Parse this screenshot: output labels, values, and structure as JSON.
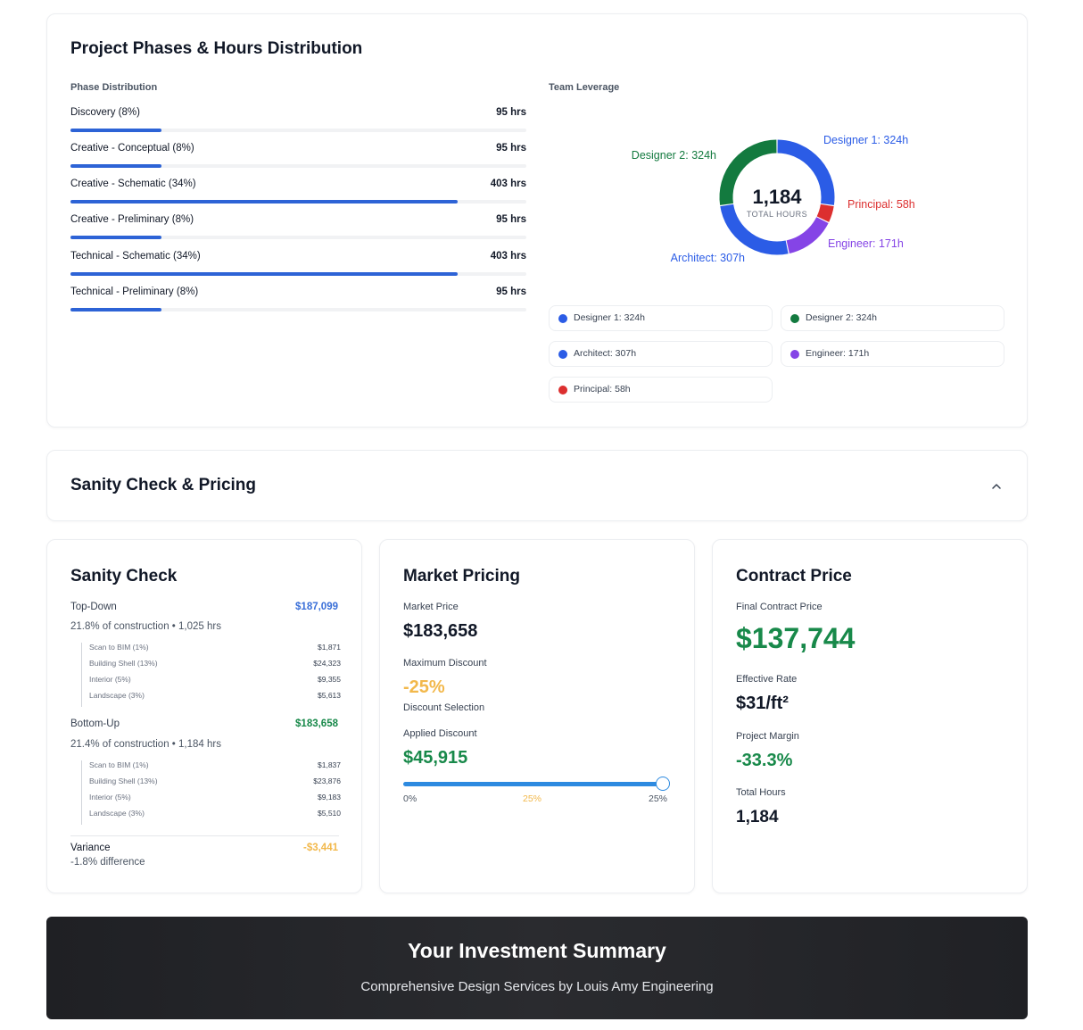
{
  "phases_card": {
    "title": "Project Phases & Hours Distribution",
    "phase_label": "Phase Distribution",
    "team_label": "Team Leverage",
    "phases": [
      {
        "name": "Discovery (8%)",
        "hours": "95 hrs",
        "fraction": 0.2
      },
      {
        "name": "Creative - Conceptual (8%)",
        "hours": "95 hrs",
        "fraction": 0.2
      },
      {
        "name": "Creative - Schematic (34%)",
        "hours": "403 hrs",
        "fraction": 0.85
      },
      {
        "name": "Creative - Preliminary (8%)",
        "hours": "95 hrs",
        "fraction": 0.2
      },
      {
        "name": "Technical - Schematic (34%)",
        "hours": "403 hrs",
        "fraction": 0.85
      },
      {
        "name": "Technical - Preliminary (8%)",
        "hours": "95 hrs",
        "fraction": 0.2
      }
    ]
  },
  "chart_data": {
    "type": "pie",
    "center_value": "1,184",
    "center_label": "TOTAL HOURS",
    "slices": [
      {
        "name": "Designer 1",
        "value": 324,
        "label": "Designer 1: 324h",
        "color": "#2b5ce6"
      },
      {
        "name": "Principal",
        "value": 58,
        "label": "Principal: 58h",
        "color": "#dc2f2f"
      },
      {
        "name": "Engineer",
        "value": 171,
        "label": "Engineer: 171h",
        "color": "#8544e6"
      },
      {
        "name": "Architect",
        "value": 307,
        "label": "Architect: 307h",
        "color": "#2b5ce6"
      },
      {
        "name": "Designer 2",
        "value": 324,
        "label": "Designer 2: 324h",
        "color": "#137a3f"
      }
    ]
  },
  "legend": [
    {
      "label": "Designer 1: 324h",
      "color": "#2b5ce6"
    },
    {
      "label": "Designer 2: 324h",
      "color": "#137a3f"
    },
    {
      "label": "Architect: 307h",
      "color": "#2b5ce6"
    },
    {
      "label": "Engineer: 171h",
      "color": "#8544e6"
    },
    {
      "label": "Principal: 58h",
      "color": "#dc2f2f"
    }
  ],
  "sanity_header": {
    "title": "Sanity Check & Pricing",
    "icon": "chevron-up-icon"
  },
  "sanity_check": {
    "title": "Sanity Check",
    "top_down": {
      "label": "Top-Down",
      "value": "$187,099",
      "sub": "21.8% of construction • 1,025 hrs",
      "items": [
        {
          "label": "Scan to BIM (1%)",
          "value": "$1,871"
        },
        {
          "label": "Building Shell (13%)",
          "value": "$24,323"
        },
        {
          "label": "Interior (5%)",
          "value": "$9,355"
        },
        {
          "label": "Landscape (3%)",
          "value": "$5,613"
        }
      ]
    },
    "bottom_up": {
      "label": "Bottom-Up",
      "value": "$183,658",
      "sub": "21.4% of construction • 1,184 hrs",
      "items": [
        {
          "label": "Scan to BIM (1%)",
          "value": "$1,837"
        },
        {
          "label": "Building Shell (13%)",
          "value": "$23,876"
        },
        {
          "label": "Interior (5%)",
          "value": "$9,183"
        },
        {
          "label": "Landscape (3%)",
          "value": "$5,510"
        }
      ]
    },
    "variance": {
      "label": "Variance",
      "value": "-$3,441",
      "sub": "-1.8% difference"
    }
  },
  "market_pricing": {
    "title": "Market Pricing",
    "market_price_label": "Market Price",
    "market_price": "$183,658",
    "max_discount_label": "Maximum Discount",
    "max_discount": "-25%",
    "discount_selection_label": "Discount Selection",
    "applied_discount_label": "Applied Discount",
    "applied_discount": "$45,915",
    "slider": {
      "min_label": "0%",
      "current_label": "25%",
      "max_label": "25%",
      "value": 25,
      "max": 25
    }
  },
  "contract_price": {
    "title": "Contract Price",
    "final_label": "Final Contract Price",
    "final_value": "$137,744",
    "rate_label": "Effective Rate",
    "rate_value": "$31/ft²",
    "margin_label": "Project Margin",
    "margin_value": "-33.3%",
    "hours_label": "Total Hours",
    "hours_value": "1,184"
  },
  "summary": {
    "title": "Your Investment Summary",
    "subtitle": "Comprehensive Design Services by Louis Amy Engineering"
  },
  "colors": {
    "accent_blue": "#2d63d6",
    "green": "#18894a",
    "orange": "#f2b84b",
    "value_blue": "#3a6fd8"
  }
}
